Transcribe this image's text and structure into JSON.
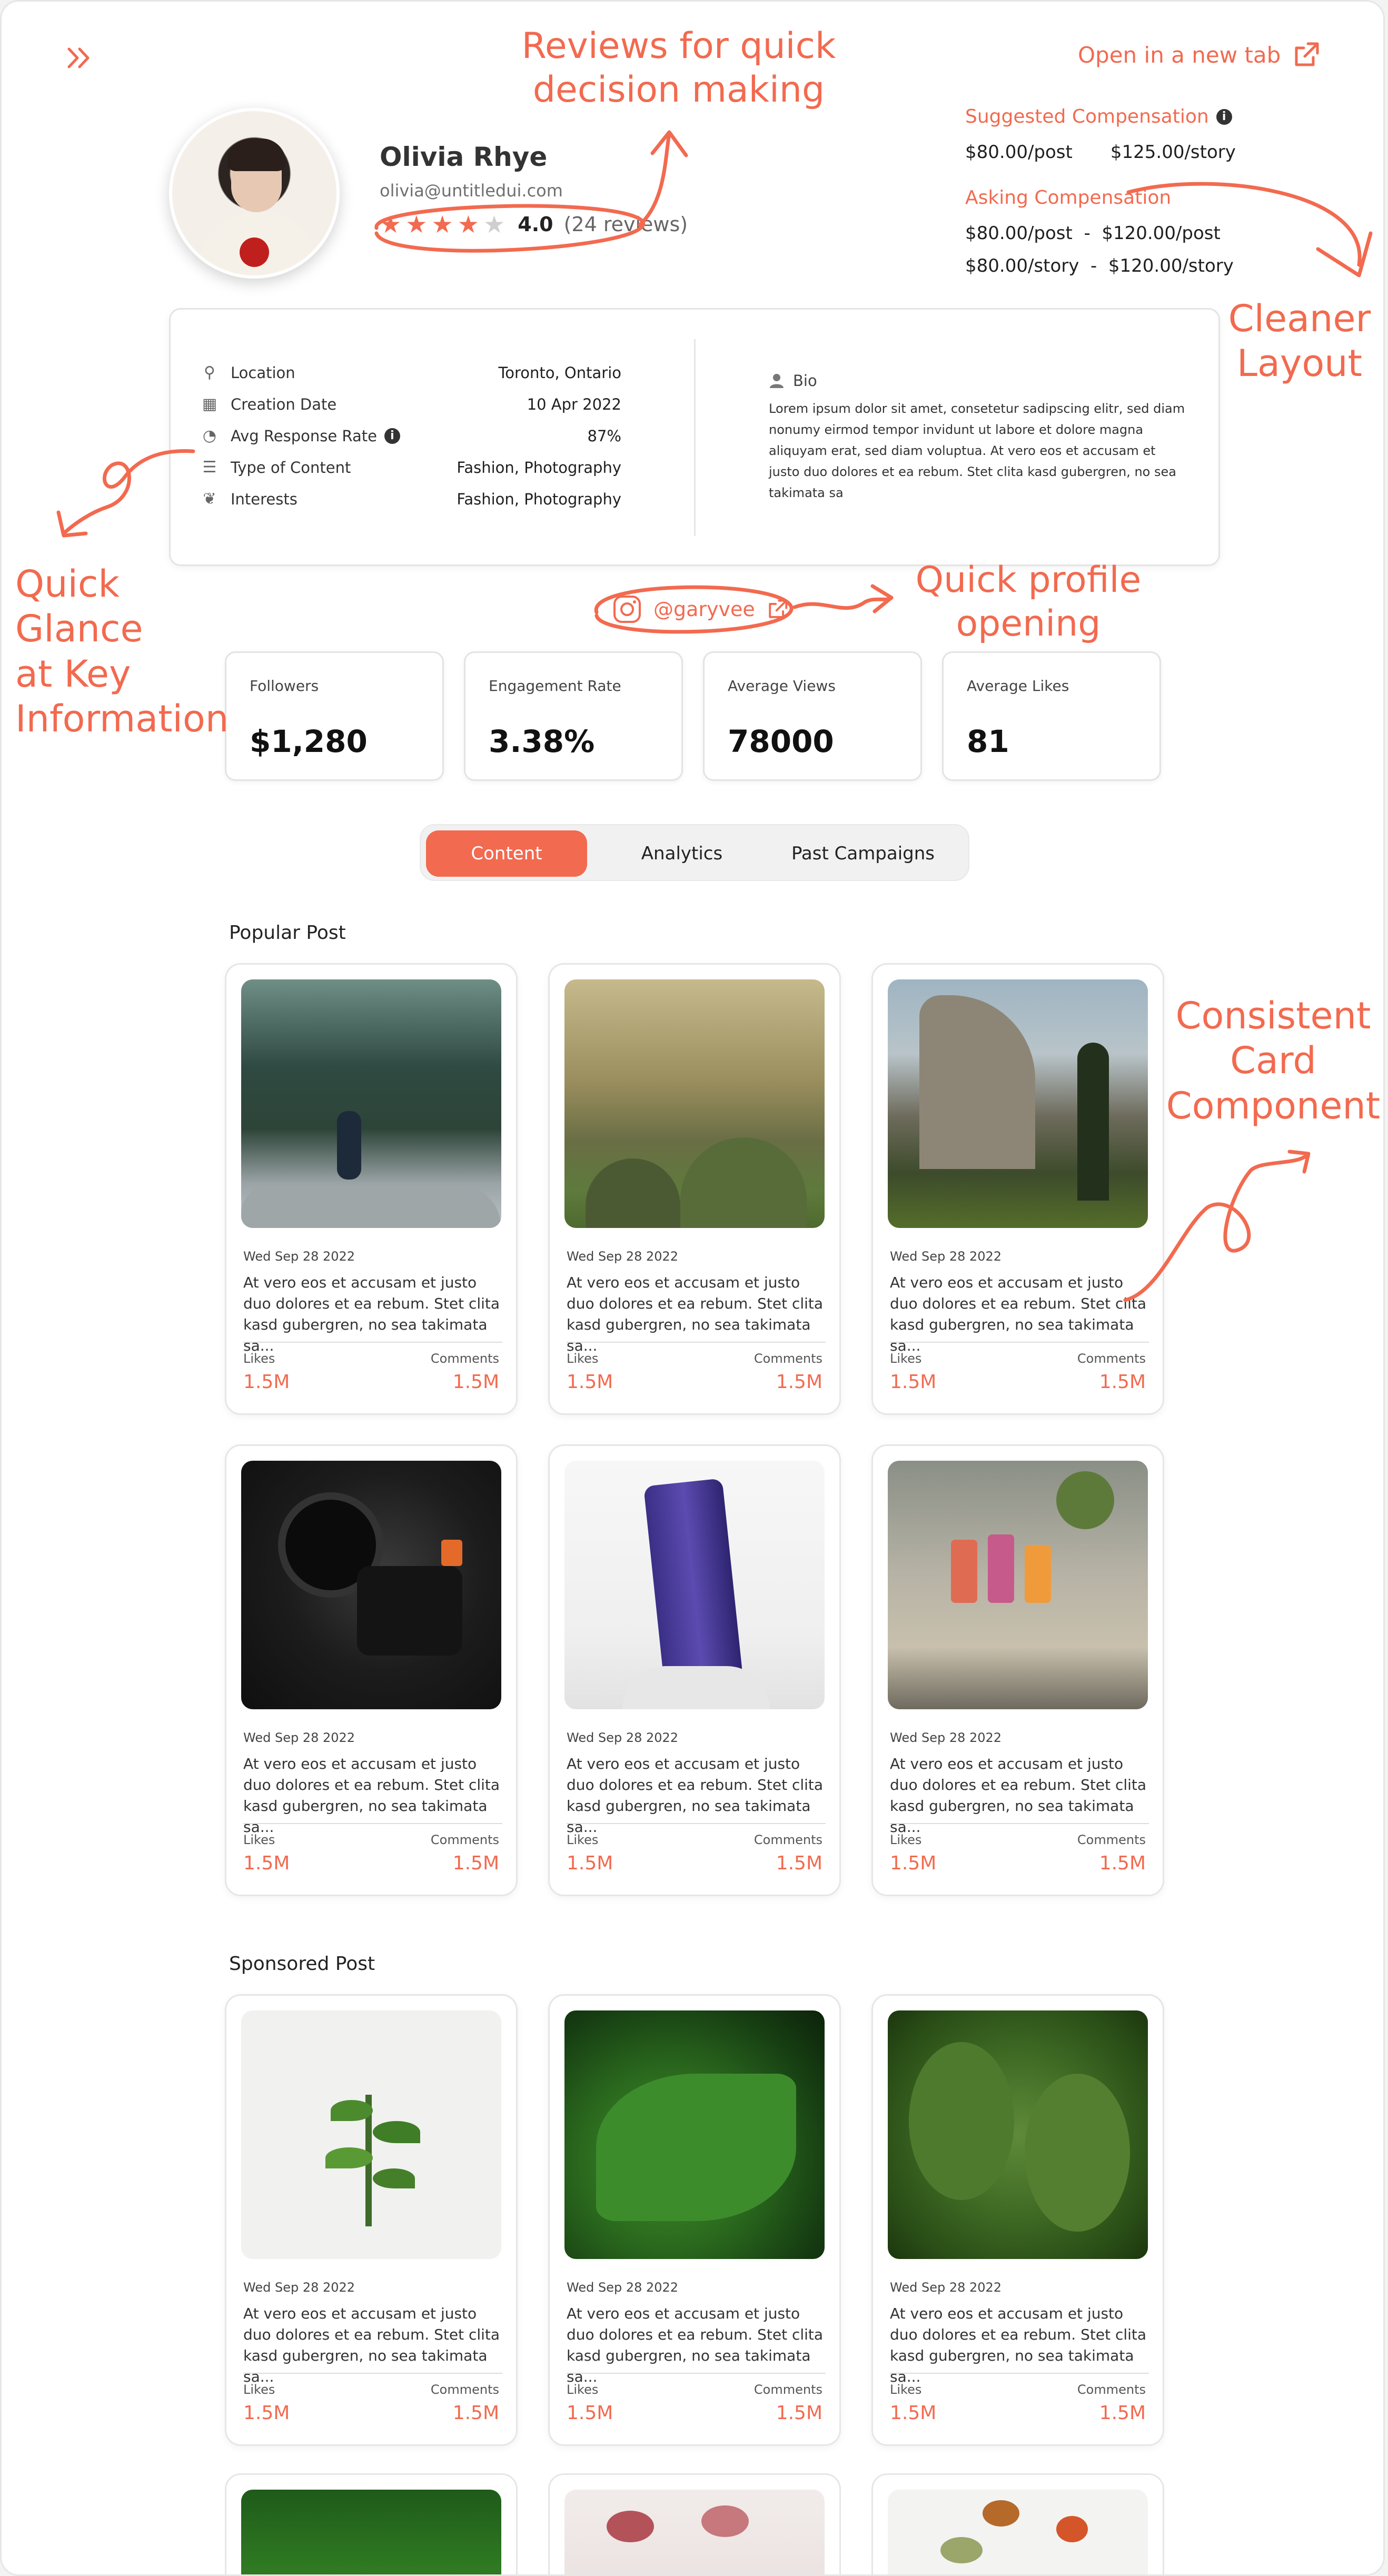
{
  "header": {
    "open_new_tab": "Open in a new tab"
  },
  "profile": {
    "name": "Olivia Rhye",
    "email": "olivia@untitledui.com",
    "rating_value": 4,
    "rating_max": 5,
    "rating_text": "4.0",
    "reviews_text": "(24 reviews)"
  },
  "compensation": {
    "suggested_label": "Suggested Compensation",
    "suggested_post": "$80.00/post",
    "suggested_story": "$125.00/story",
    "asking_label": "Asking Compensation",
    "asking_post": "$80.00/post  -  $120.00/post",
    "asking_story": "$80.00/story  -  $120.00/story"
  },
  "details": {
    "rows": [
      {
        "label": "Location",
        "value": "Toronto, Ontario",
        "icon": "location-pin-icon"
      },
      {
        "label": "Creation Date",
        "value": "10 Apr 2022",
        "icon": "calendar-icon"
      },
      {
        "label": "Avg Response Rate",
        "value": "87%",
        "icon": "response-rate-icon"
      },
      {
        "label": "Type of Content",
        "value": "Fashion, Photography",
        "icon": "content-list-icon"
      },
      {
        "label": "Interests",
        "value": "Fashion, Photography",
        "icon": "interests-icon"
      }
    ],
    "bio_label": "Bio",
    "bio_text": "Lorem ipsum dolor sit amet, consetetur sadipscing elitr, sed diam nonumy eirmod tempor invidunt ut labore et dolore magna aliquyam erat, sed diam voluptua. At vero eos et accusam et justo duo dolores et ea rebum. Stet clita kasd gubergren, no sea takimata sa"
  },
  "social": {
    "handle": "@garyvee"
  },
  "metrics": [
    {
      "label": "Followers",
      "value": "$1,280"
    },
    {
      "label": "Engagement Rate",
      "value": "3.38%"
    },
    {
      "label": "Average Views",
      "value": "78000"
    },
    {
      "label": "Average Likes",
      "value": "81"
    }
  ],
  "tabs": [
    {
      "label": "Content",
      "active": true
    },
    {
      "label": "Analytics",
      "active": false
    },
    {
      "label": "Past Campaigns",
      "active": false
    }
  ],
  "sections": {
    "popular": "Popular Post",
    "sponsored": "Sponsored Post"
  },
  "post_card": {
    "date": "Wed Sep 28 2022",
    "description": "At vero eos et accusam et justo duo dolores et ea rebum. Stet clita kasd gubergren, no sea takimata sa...",
    "likes_label": "Likes",
    "likes_value": "1.5M",
    "comments_label": "Comments",
    "comments_value": "1.5M"
  },
  "annotations": {
    "reviews": [
      "Reviews for quick",
      "decision making"
    ],
    "layout": [
      "Cleaner",
      "Layout"
    ],
    "glance": [
      "Quick Glance",
      "at Key",
      "Information"
    ],
    "profile_open": [
      "Quick profile",
      "opening"
    ],
    "card": [
      "Consistent",
      "Card",
      "Component"
    ]
  },
  "colors": {
    "accent": "#f26a4f"
  }
}
